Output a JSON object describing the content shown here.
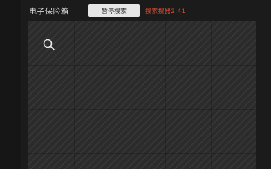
{
  "header": {
    "title": "电子保险箱",
    "pause_button_label": "暂停搜索",
    "engine_status": "搜索搜器2.41"
  },
  "icons": {
    "search": "search-icon"
  },
  "colors": {
    "background": "#1b1b1b",
    "panel": "#2b2b2b",
    "accent": "#d74a2e",
    "button": "#e6e6e6"
  }
}
